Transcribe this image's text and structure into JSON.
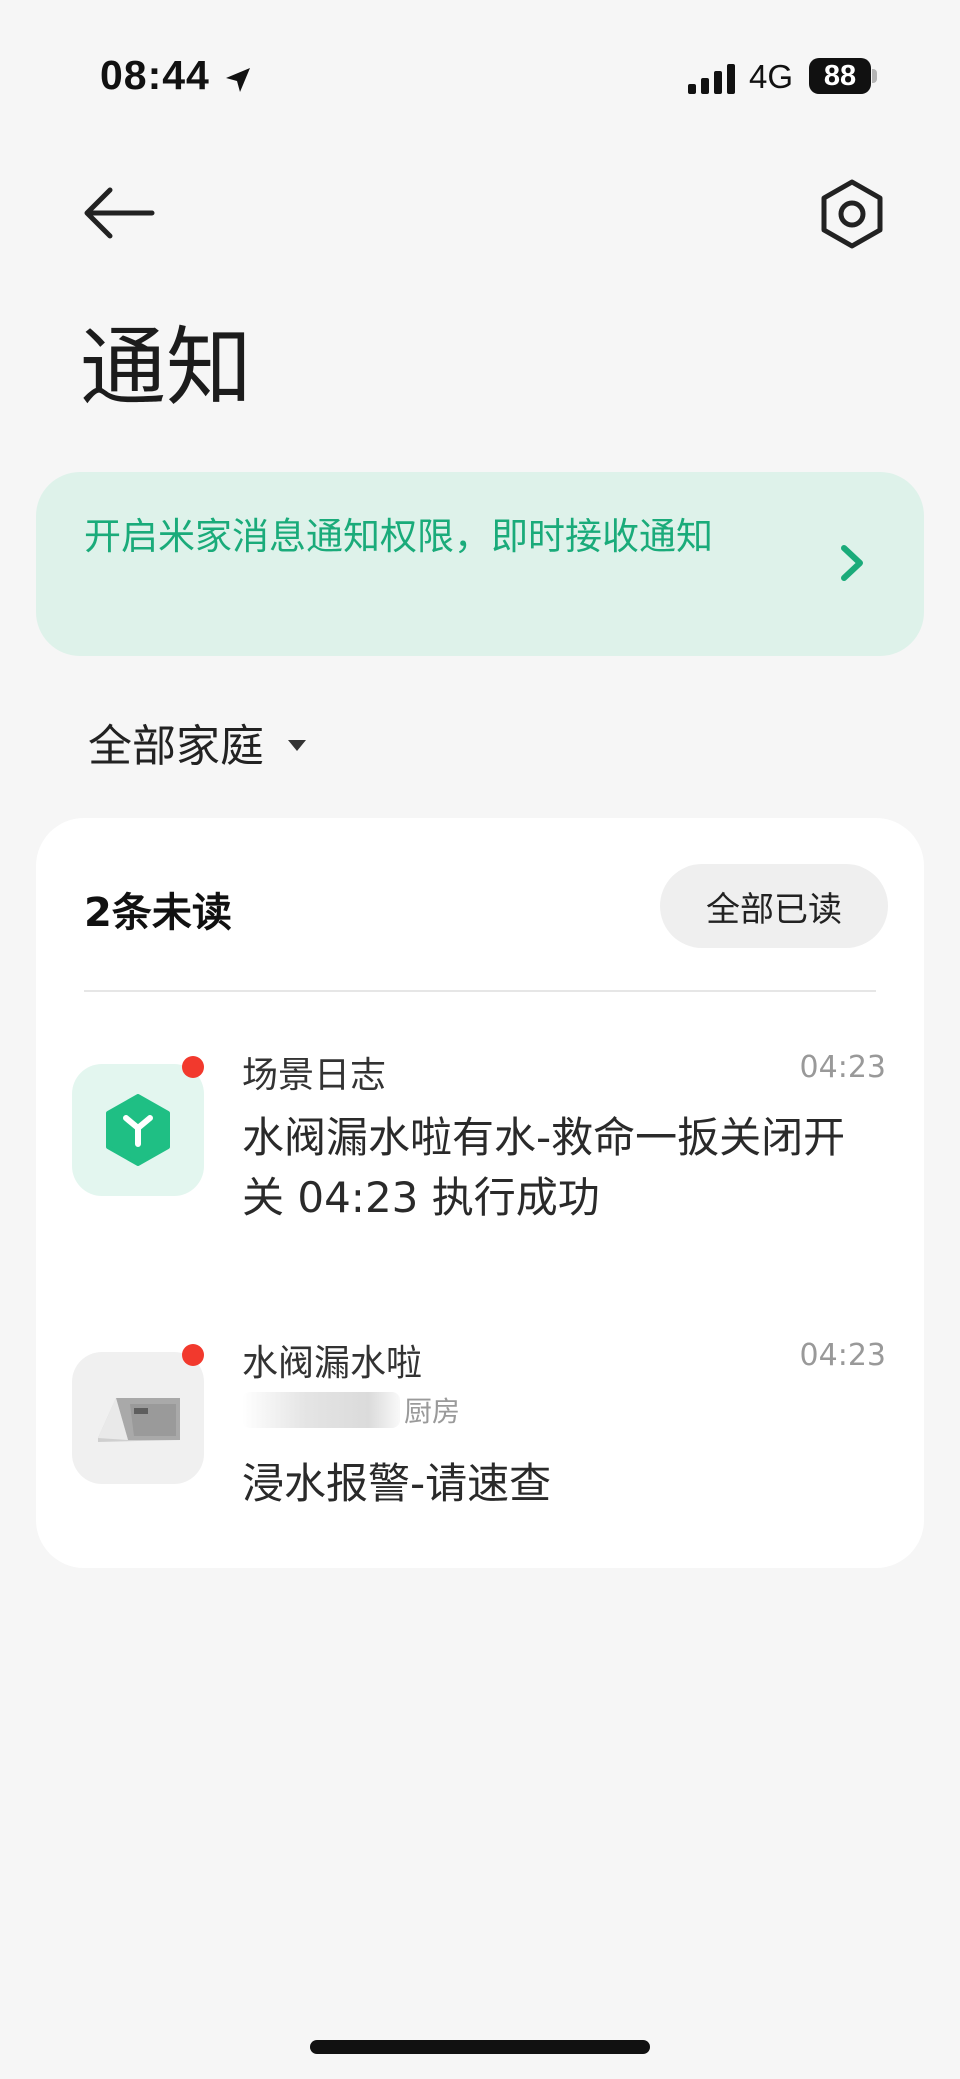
{
  "status_bar": {
    "time": "08:44",
    "network": "4G",
    "battery": "88"
  },
  "header": {
    "title": "通知",
    "back_icon": "arrow-left-icon",
    "settings_icon": "gear-hex-icon"
  },
  "banner": {
    "text": "开启米家消息通知权限，即时接收通知",
    "accent_color": "#1aab7a",
    "background_color": "#def2ea"
  },
  "home_filter": {
    "selected": "全部家庭"
  },
  "notifications": {
    "unread_label": "2条未读",
    "mark_all_read_label": "全部已读",
    "items": [
      {
        "title": "场景日志",
        "time": "04:23",
        "body": "水阀漏水啦有水-救命一扳关闭开关 04:23 执行成功",
        "icon": "scene-cube-icon",
        "unread": true
      },
      {
        "title": "水阀漏水啦",
        "time": "04:23",
        "room": "厨房",
        "body": "浸水报警-请速查",
        "icon": "water-sensor-device-icon",
        "unread": true
      }
    ]
  }
}
